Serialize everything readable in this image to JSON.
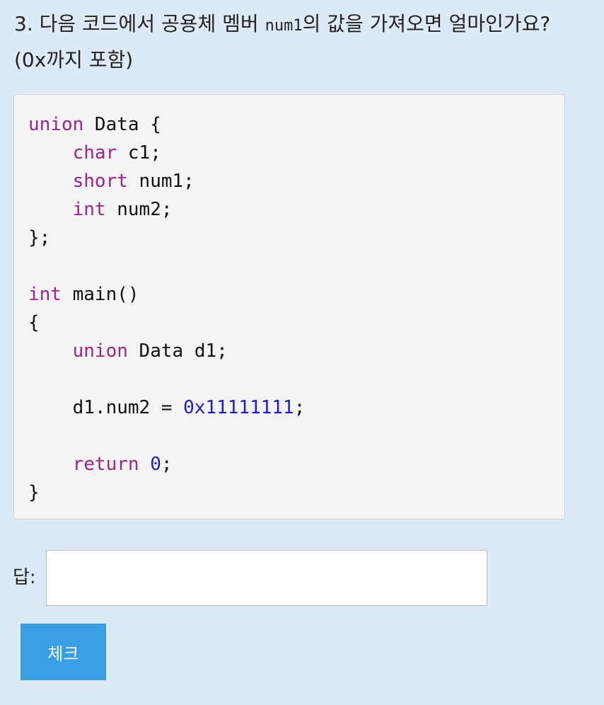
{
  "question": {
    "prefix": "3. 다음 코드에서 공용체 멤버 ",
    "code_term": "num1",
    "suffix": "의 값을 가져오면 얼마인가요? (0x까지 포함)"
  },
  "code": {
    "lines": [
      [
        {
          "t": "union",
          "c": "kw"
        },
        {
          "t": " Data {"
        }
      ],
      [
        {
          "t": "    "
        },
        {
          "t": "char",
          "c": "kw"
        },
        {
          "t": " c1;"
        }
      ],
      [
        {
          "t": "    "
        },
        {
          "t": "short",
          "c": "kw"
        },
        {
          "t": " num1;"
        }
      ],
      [
        {
          "t": "    "
        },
        {
          "t": "int",
          "c": "kw"
        },
        {
          "t": " num2;"
        }
      ],
      [
        {
          "t": "};"
        }
      ],
      [],
      [
        {
          "t": "int",
          "c": "kw"
        },
        {
          "t": " main()"
        }
      ],
      [
        {
          "t": "{"
        }
      ],
      [
        {
          "t": "    "
        },
        {
          "t": "union",
          "c": "kw"
        },
        {
          "t": " Data d1;"
        }
      ],
      [],
      [
        {
          "t": "    d1.num2 = "
        },
        {
          "t": "0x11111111",
          "c": "num"
        },
        {
          "t": ";"
        }
      ],
      [],
      [
        {
          "t": "    "
        },
        {
          "t": "return",
          "c": "kw"
        },
        {
          "t": " "
        },
        {
          "t": "0",
          "c": "num"
        },
        {
          "t": ";"
        }
      ],
      [
        {
          "t": "}"
        }
      ]
    ]
  },
  "answer": {
    "label": "답:",
    "value": "",
    "placeholder": ""
  },
  "check_button": {
    "label": "체크"
  },
  "colors": {
    "background": "#dbeaf5",
    "keyword": "#a0228c",
    "number": "#1c1ccf",
    "button": "#3a9ee4"
  }
}
